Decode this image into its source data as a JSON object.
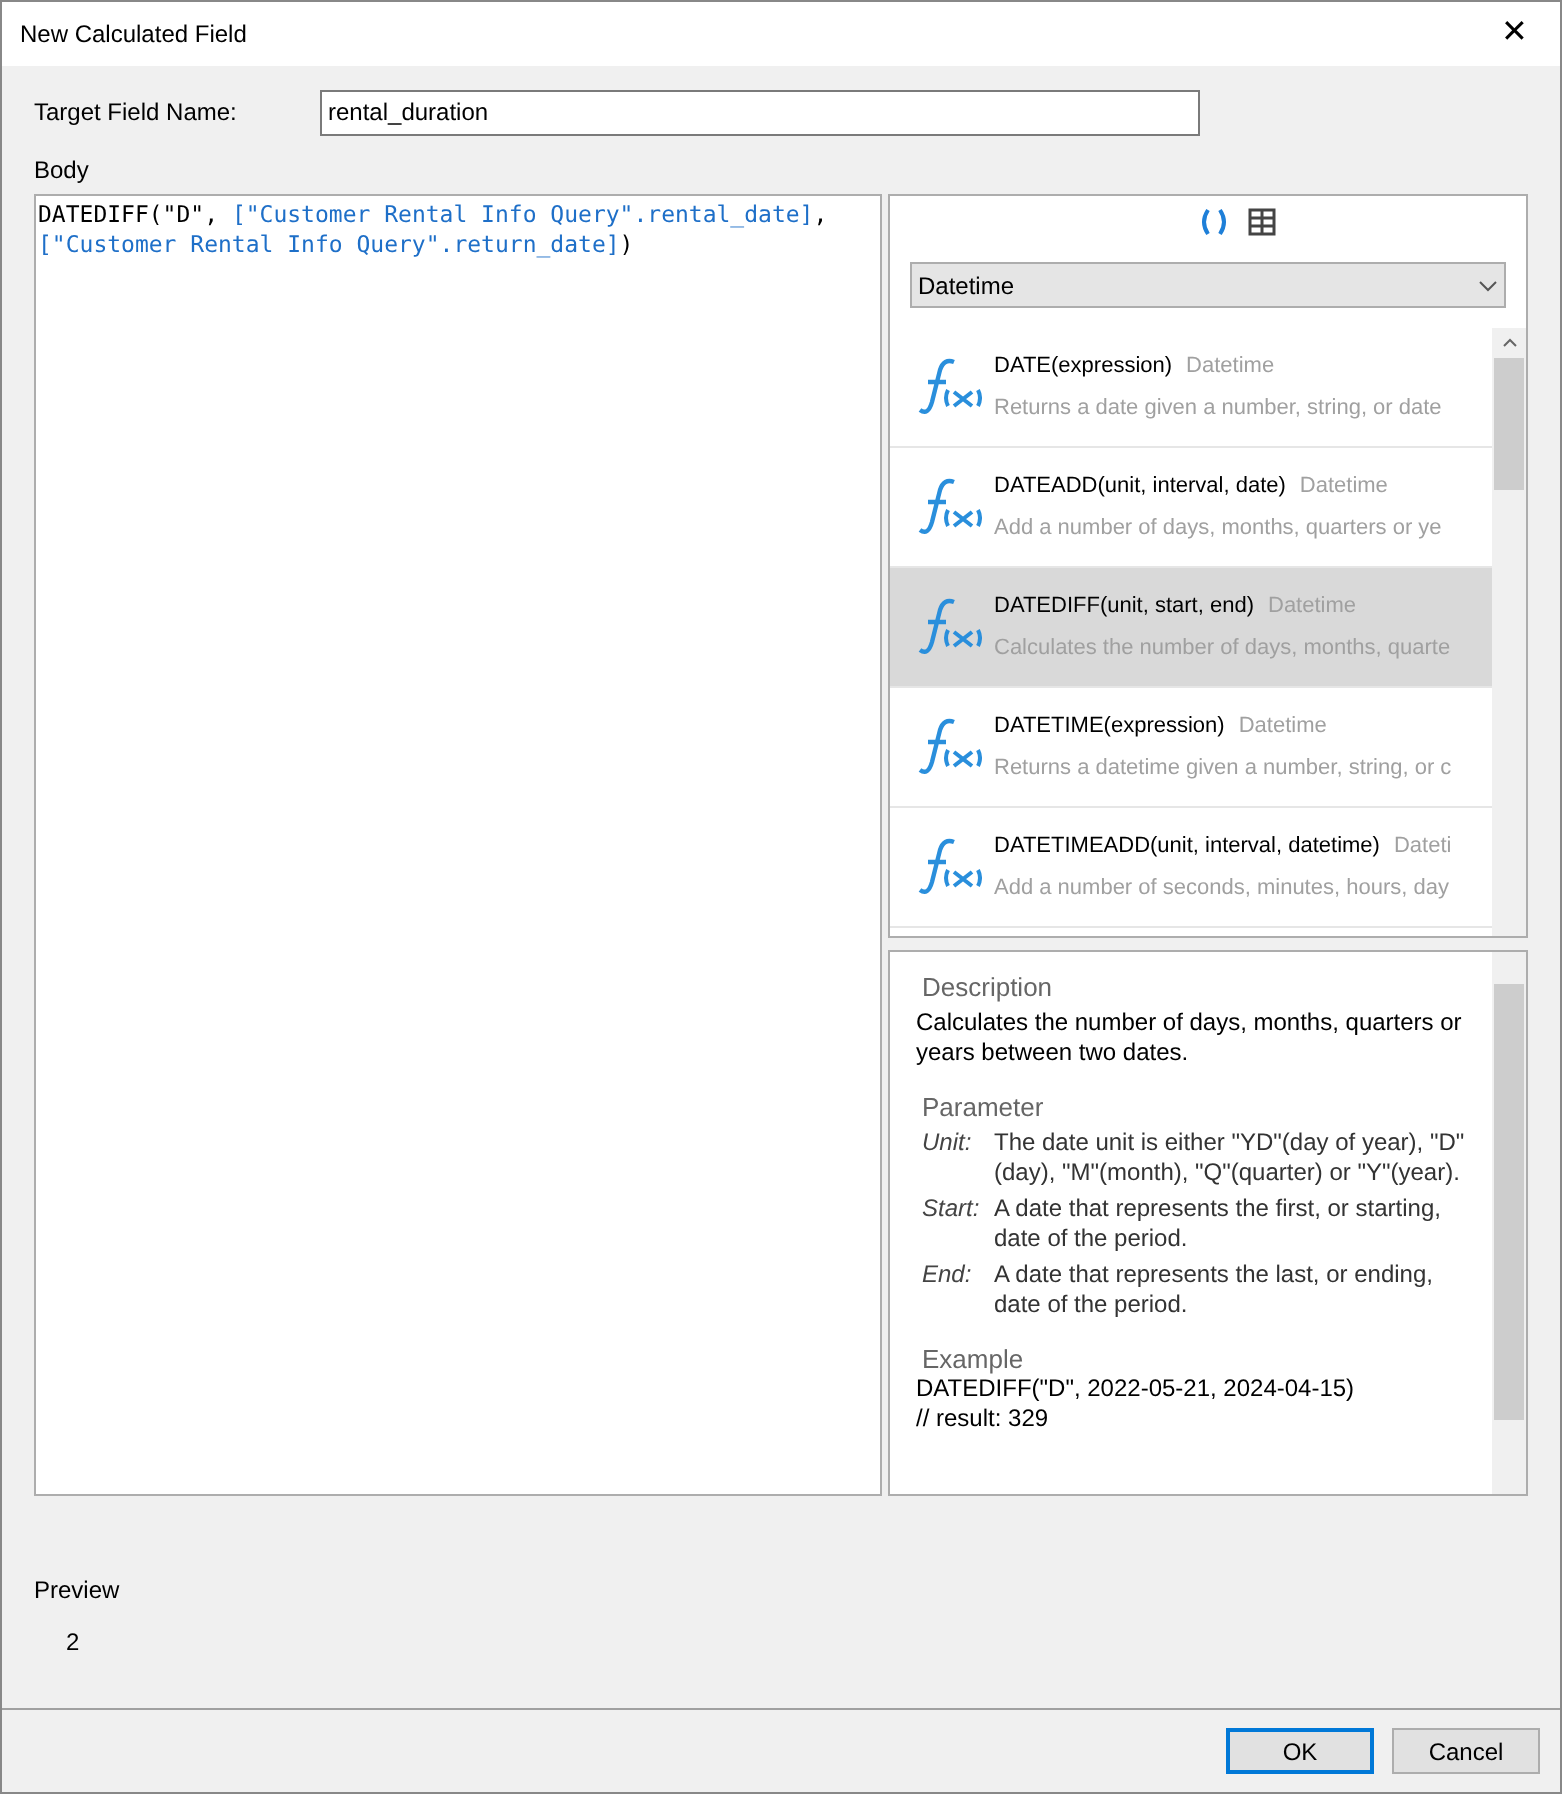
{
  "window": {
    "title": "New Calculated Field",
    "close": "✕"
  },
  "target_field": {
    "label": "Target Field Name:",
    "value": "rental_duration"
  },
  "body": {
    "label": "Body",
    "code_lines": [
      [
        {
          "kind": "plain",
          "text": "DATEDIFF(\"D\", "
        },
        {
          "kind": "field",
          "text": "[\"Customer Rental Info Query\".rental_date]"
        },
        {
          "kind": "plain",
          "text": ","
        }
      ],
      [
        {
          "kind": "field",
          "text": "[\"Customer Rental Info Query\".return_date]"
        },
        {
          "kind": "plain",
          "text": ")"
        }
      ]
    ]
  },
  "category_select": {
    "value": "Datetime"
  },
  "functions": [
    {
      "signature": "DATE(expression)",
      "category": "Datetime",
      "summary": "Returns a date given a number, string, or date",
      "selected": false
    },
    {
      "signature": "DATEADD(unit, interval, date)",
      "category": "Datetime",
      "summary": "Add a number of days, months, quarters or ye",
      "selected": false
    },
    {
      "signature": "DATEDIFF(unit, start, end)",
      "category": "Datetime",
      "summary": "Calculates the number of days, months, quarte",
      "selected": true
    },
    {
      "signature": "DATETIME(expression)",
      "category": "Datetime",
      "summary": "Returns a datetime given a number, string, or c",
      "selected": false
    },
    {
      "signature": "DATETIMEADD(unit, interval, datetime)",
      "category": "Dateti",
      "summary": "Add a number of seconds, minutes, hours, day",
      "selected": false
    }
  ],
  "description": {
    "heading": "Description",
    "text": "Calculates the number of days, months, quarters or years between two dates.",
    "parameter_heading": "Parameter",
    "parameters": [
      {
        "name": "Unit:",
        "text": "The date unit is either \"YD\"(day of year), \"D\"(day), \"M\"(month), \"Q\"(quarter) or \"Y\"(year)."
      },
      {
        "name": "Start:",
        "text": "A date that represents the first, or starting, date of the period."
      },
      {
        "name": "End:",
        "text": "A date that represents the last, or ending, date of the period."
      }
    ],
    "example_heading": "Example",
    "example_lines": [
      "DATEDIFF(\"D\", 2022-05-21, 2024-04-15)",
      "// result: 329"
    ]
  },
  "preview": {
    "label": "Preview",
    "value": "2"
  },
  "buttons": [
    {
      "label": "OK",
      "default": true
    },
    {
      "label": "Cancel",
      "default": false
    }
  ]
}
